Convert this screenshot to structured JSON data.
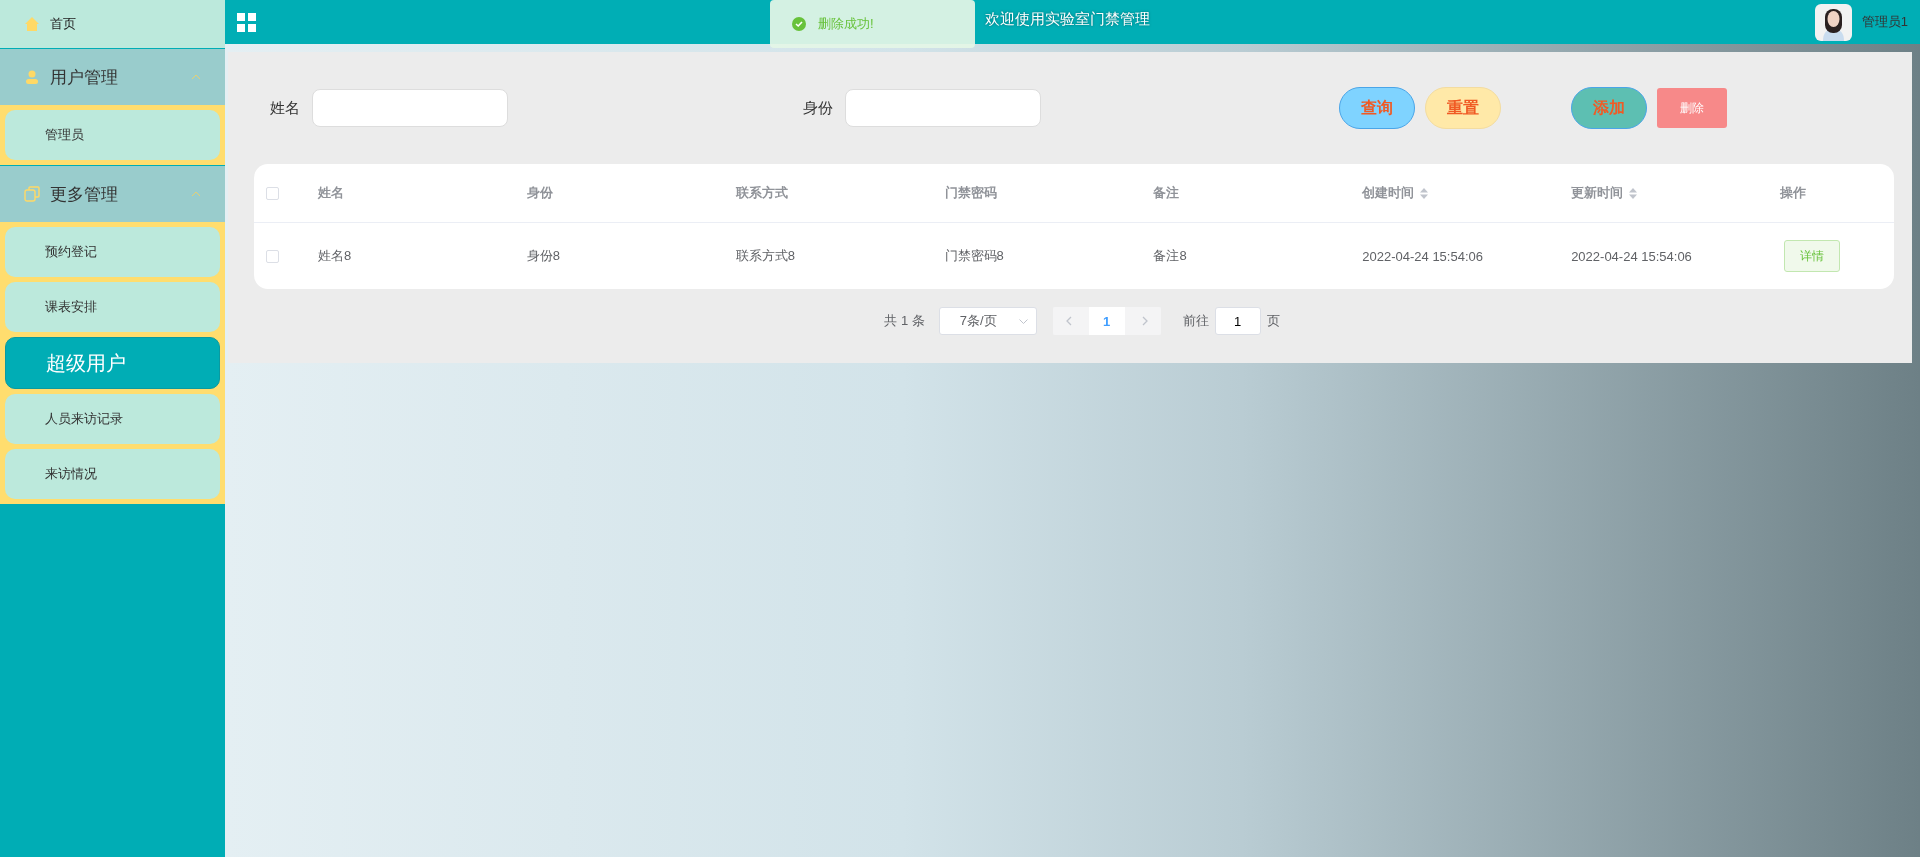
{
  "sidebar": {
    "items": [
      {
        "kind": "link",
        "label": "首页"
      },
      {
        "kind": "group",
        "label": "用户管理",
        "expanded": true,
        "children": [
          {
            "label": "管理员",
            "selected": false
          }
        ]
      },
      {
        "kind": "group",
        "label": "更多管理",
        "expanded": true,
        "children": [
          {
            "label": "预约登记",
            "selected": false
          },
          {
            "label": "课表安排",
            "selected": false
          },
          {
            "label": "超级用户",
            "selected": true
          },
          {
            "label": "人员来访记录",
            "selected": false
          },
          {
            "label": "来访情况",
            "selected": false
          }
        ]
      }
    ]
  },
  "header": {
    "title": "欢迎使用实验室门禁管理",
    "user": "管理员1"
  },
  "toast": {
    "kind": "success",
    "message": "删除成功!"
  },
  "search": {
    "fields": [
      {
        "label": "姓名"
      },
      {
        "label": "身份"
      }
    ],
    "buttons": [
      {
        "kind": "query",
        "label": "查询"
      },
      {
        "kind": "reset",
        "label": "重置"
      },
      {
        "kind": "add",
        "label": "添加"
      },
      {
        "kind": "delete",
        "label": "删除"
      }
    ]
  },
  "table": {
    "select_all_checked": false,
    "columns": [
      {
        "label": "姓名",
        "sortable": false
      },
      {
        "label": "身份",
        "sortable": false
      },
      {
        "label": "联系方式",
        "sortable": false
      },
      {
        "label": "门禁密码",
        "sortable": false
      },
      {
        "label": "备注",
        "sortable": false
      },
      {
        "label": "创建时间",
        "sortable": true
      },
      {
        "label": "更新时间",
        "sortable": true
      },
      {
        "label": "操作",
        "sortable": false
      }
    ],
    "rows": [
      {
        "checked": false,
        "cells": [
          "姓名8",
          "身份8",
          "联系方式8",
          "门禁密码8",
          "备注8",
          "2022-04-24 15:54:06",
          "2022-04-24 15:54:06"
        ],
        "action": "详情"
      }
    ]
  },
  "pagination": {
    "total": "共 1 条",
    "page_size": "7条/页",
    "pages": [
      {
        "label": "1",
        "selected": true
      }
    ],
    "goto_label": "前往",
    "goto_value": "1",
    "goto_suffix": "页"
  }
}
